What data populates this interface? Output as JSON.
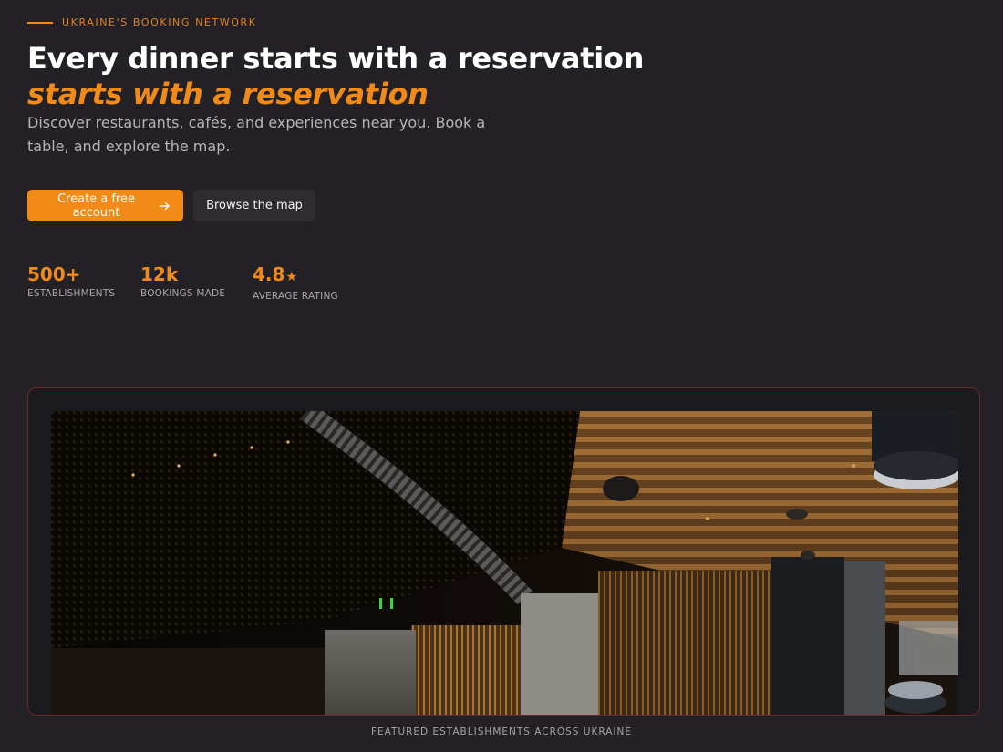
{
  "hero": {
    "eyebrow": "UKRAINE'S BOOKING NETWORK",
    "headline": "Every dinner starts with a reservation",
    "headline_accent": "starts with a reservation",
    "subtitle": "Discover restaurants, cafés, and experiences near you. Book a table, and explore the map."
  },
  "actions": {
    "primary_label": "Create a free account",
    "primary_icon": "arrow-right-icon",
    "secondary_label": "Browse the map"
  },
  "stats": [
    {
      "value": "500+",
      "label": "ESTABLISHMENTS"
    },
    {
      "value": "12k",
      "label": "BOOKINGS MADE"
    },
    {
      "value": "4.8",
      "label": "AVERAGE RATING",
      "icon": "star-icon",
      "icon_glyph": "★"
    }
  ],
  "showcase": {
    "caption": "FEATURED ESTABLISHMENTS ACROSS UKRAINE"
  },
  "colors": {
    "background": "#232125",
    "accent": "#f28a17",
    "secondary_button": "#2e2c31",
    "showcase_border": "#6b2a26"
  }
}
